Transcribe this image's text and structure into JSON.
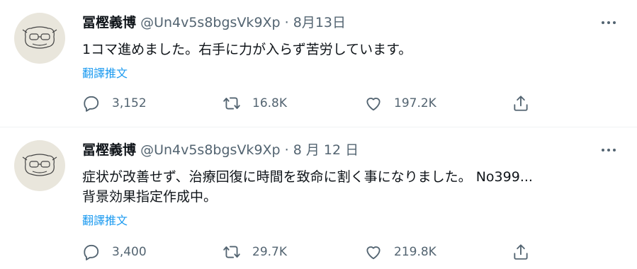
{
  "tweets": [
    {
      "name": "冨樫義博",
      "handle": "@Un4v5s8bgsVk9Xp",
      "dot": "·",
      "date": "8月13日",
      "text_lines": [
        "1コマ進めました。右手に力が入らず苦労しています。"
      ],
      "translate": "翻譯推文",
      "replies": "3,152",
      "retweets": "16.8K",
      "likes": "197.2K"
    },
    {
      "name": "冨樫義博",
      "handle": "@Un4v5s8bgsVk9Xp",
      "dot": "·",
      "date": "8 月 12 日",
      "text_lines": [
        "症状が改善せず、治療回復に時間を致命に割く事になりました。 No399...",
        "背景効果指定作成中。"
      ],
      "translate": "翻譯推文",
      "replies": "3,400",
      "retweets": "29.7K",
      "likes": "219.8K"
    }
  ],
  "icons": {
    "reply": "reply-icon",
    "retweet": "retweet-icon",
    "like": "heart-icon",
    "share": "share-icon",
    "more": "more-icon"
  },
  "colors": {
    "link": "#1d9bf0",
    "secondary_text": "#536471",
    "divider": "#eff3f4"
  }
}
